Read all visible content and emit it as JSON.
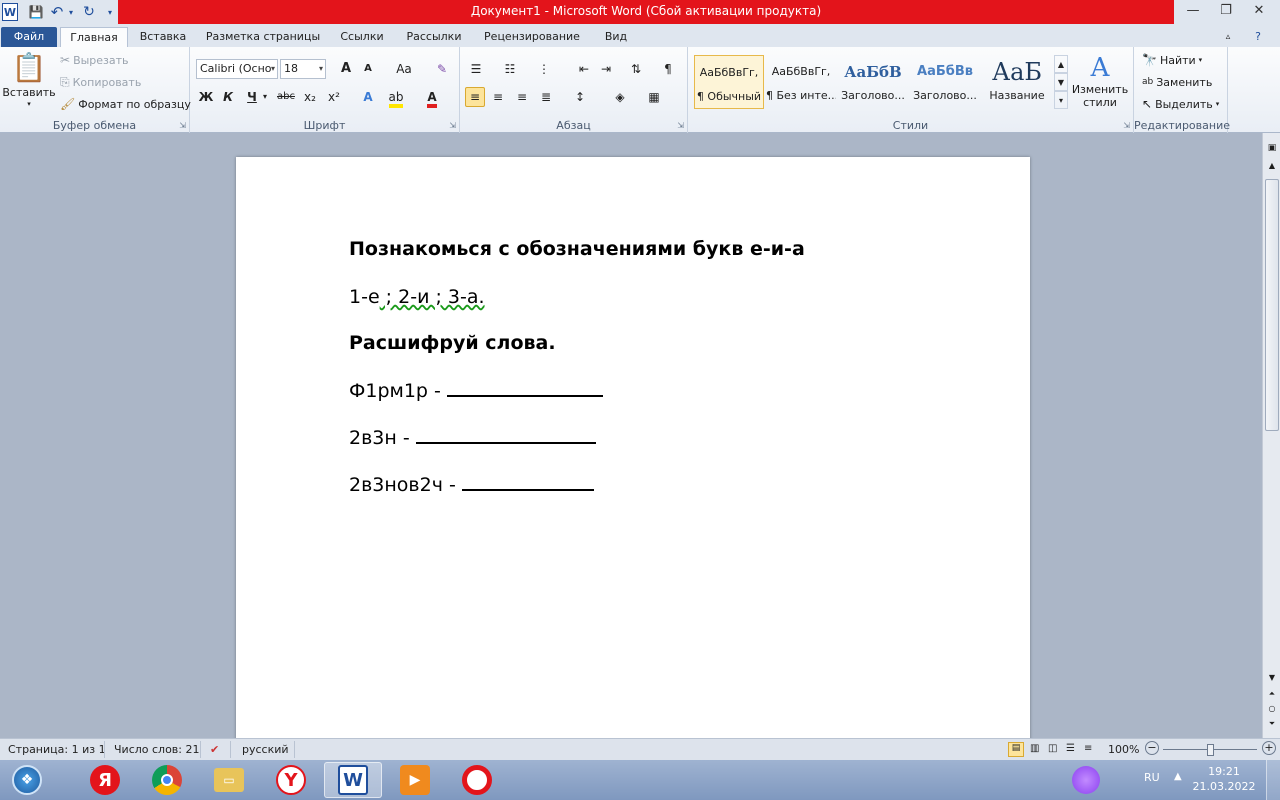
{
  "window": {
    "title": "Документ1  -  Microsoft Word (Сбой активации продукта)",
    "controls": {
      "minimize": "—",
      "restore": "❐",
      "close": "✕"
    }
  },
  "qat": {
    "word_icon": "W",
    "save": "💾",
    "undo": "↶",
    "redo": "↻"
  },
  "tabs": {
    "file": "Файл",
    "items": [
      "Главная",
      "Вставка",
      "Разметка страницы",
      "Ссылки",
      "Рассылки",
      "Рецензирование",
      "Вид"
    ]
  },
  "clipboard": {
    "paste": "Вставить",
    "cut": "Вырезать",
    "copy": "Копировать",
    "format_painter": "Формат по образцу",
    "label": "Буфер обмена"
  },
  "font": {
    "name": "Calibri (Осно",
    "size": "18",
    "label": "Шрифт",
    "bold": "Ж",
    "italic": "К",
    "underline": "Ч",
    "strike": "abc",
    "sub": "x₂",
    "sup": "x²",
    "grow": "A",
    "shrink": "A",
    "case": "Aa"
  },
  "paragraph": {
    "label": "Абзац",
    "pilcrow": "¶"
  },
  "styles": {
    "label": "Стили",
    "items": [
      {
        "preview": "АаБбВвГг,",
        "name": "¶ Обычный"
      },
      {
        "preview": "АаБбВвГг,",
        "name": "¶ Без инте..."
      },
      {
        "preview": "АаБбВ",
        "name": "Заголово..."
      },
      {
        "preview": "АаБбВв",
        "name": "Заголово..."
      },
      {
        "preview": "АаБ",
        "name": "Название"
      }
    ],
    "change": "Изменить стили"
  },
  "editing": {
    "label": "Редактирование",
    "find": "Найти",
    "replace": "Заменить",
    "select": "Выделить"
  },
  "document": {
    "line1": "Познакомься с обозначениями букв е-и-а",
    "line2_a": "1-е",
    "line2_b": " ; 2-и ; 3-а.",
    "line3": "Расшифруй слова.",
    "word1": "Ф1рм1р - ",
    "word2": "2в3н - ",
    "word3": "2в3нов2ч - "
  },
  "status": {
    "page": "Страница: 1 из 1",
    "words": "Число слов: 21",
    "lang": "русский",
    "zoom": "100%",
    "zoom_level_percent": 100
  },
  "taskbar": {
    "apps": [
      "start-orb",
      "yandex",
      "chrome",
      "explorer",
      "yandex-browser",
      "word",
      "video-player",
      "opera"
    ],
    "lang": "RU",
    "time": "19:21",
    "date": "21.03.2022"
  }
}
